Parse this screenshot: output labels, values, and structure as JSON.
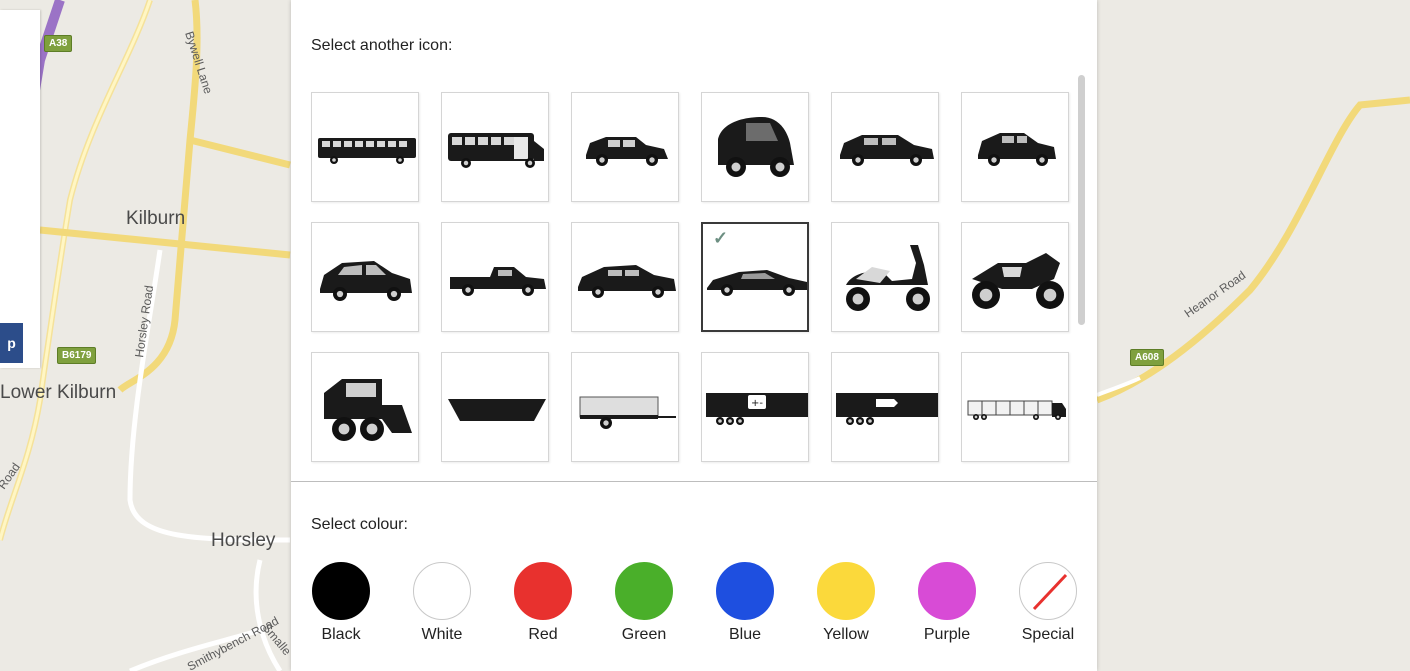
{
  "map": {
    "places": {
      "kilburn": "Kilburn",
      "lower_kilburn": "Lower Kilburn",
      "horsley": "Horsley"
    },
    "roads": {
      "bywell_lane": "Bywell Lane",
      "horsley_road": "Horsley Road",
      "heanor_road": "Heanor Road",
      "road_fragment": "Road",
      "smithybench_road": "Smithybench Road",
      "small_fragment": "Smalle"
    },
    "shields": {
      "a38": "A38",
      "b6179": "B6179",
      "a608": "A608"
    },
    "ghost_button_label": "p"
  },
  "dialog": {
    "icon_section_label": "Select another icon:",
    "colour_section_label": "Select colour:",
    "icons": [
      {
        "name": "bus",
        "selected": false
      },
      {
        "name": "minibus",
        "selected": false
      },
      {
        "name": "suv",
        "selected": false
      },
      {
        "name": "smart-car",
        "selected": false
      },
      {
        "name": "estate-car",
        "selected": false
      },
      {
        "name": "hatchback",
        "selected": false
      },
      {
        "name": "compact-car",
        "selected": false
      },
      {
        "name": "pickup-truck",
        "selected": false
      },
      {
        "name": "saloon",
        "selected": false
      },
      {
        "name": "sports-car",
        "selected": true
      },
      {
        "name": "scooter",
        "selected": false
      },
      {
        "name": "motorbike",
        "selected": false
      },
      {
        "name": "skid-steer-loader",
        "selected": false
      },
      {
        "name": "skip",
        "selected": false
      },
      {
        "name": "trailer",
        "selected": false
      },
      {
        "name": "battery-trailer",
        "selected": false
      },
      {
        "name": "tag-trailer",
        "selected": false
      },
      {
        "name": "articulated-lorry",
        "selected": false
      }
    ],
    "check_mark": "✓",
    "colours": [
      {
        "label": "Black",
        "hex": "#000000"
      },
      {
        "label": "White",
        "hex": "#ffffff"
      },
      {
        "label": "Red",
        "hex": "#e8312e"
      },
      {
        "label": "Green",
        "hex": "#4aaf2a"
      },
      {
        "label": "Blue",
        "hex": "#1e4fe0"
      },
      {
        "label": "Yellow",
        "hex": "#fbd93b"
      },
      {
        "label": "Purple",
        "hex": "#d84bd6"
      },
      {
        "label": "Special",
        "hex": "#ffffff"
      }
    ]
  }
}
